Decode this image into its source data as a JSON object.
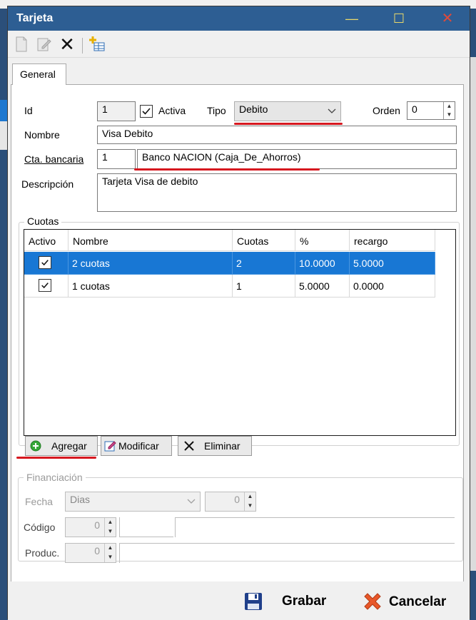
{
  "window": {
    "title": "Tarjeta"
  },
  "titlebar": {
    "min_glyph": "—",
    "max_glyph": "☐",
    "close_glyph": "✕"
  },
  "toolbar": {
    "delete_glyph": "✕"
  },
  "tabs": [
    {
      "label": "General"
    }
  ],
  "form": {
    "id_label": "Id",
    "id_value": "1",
    "activa_label": "Activa",
    "activa_checked": true,
    "tipo_label": "Tipo",
    "tipo_value": "Debito",
    "orden_label": "Orden",
    "orden_value": "0",
    "nombre_label": "Nombre",
    "nombre_value": "Visa Debito",
    "cta_label": "Cta. bancaria",
    "cta_code": "1",
    "cta_name": "Banco NACION (Caja_De_Ahorros)",
    "descripcion_label": "Descripción",
    "descripcion_value": "Tarjeta Visa de debito"
  },
  "cuotas": {
    "group_label": "Cuotas",
    "columns": [
      "Activo",
      "Nombre",
      "Cuotas",
      "%",
      "recargo"
    ],
    "rows": [
      {
        "activo": true,
        "nombre": "2 cuotas",
        "cuotas": "2",
        "pct": "10.0000",
        "recargo": "5.0000",
        "selected": true
      },
      {
        "activo": true,
        "nombre": "1 cuotas",
        "cuotas": "1",
        "pct": "5.0000",
        "recargo": "0.0000",
        "selected": false
      }
    ],
    "btn_agregar": "Agregar",
    "btn_modificar": "Modificar",
    "btn_eliminar": "Eliminar"
  },
  "financiacion": {
    "group_label": "Financiación",
    "fecha_label": "Fecha",
    "fecha_value": "Dias",
    "fecha_num": "0",
    "codigo_label": "Código",
    "codigo_value": "0",
    "produc_label": "Produc.",
    "produc_value": "0"
  },
  "footer": {
    "grabar": "Grabar",
    "cancelar": "Cancelar"
  },
  "colors": {
    "title_bar": "#2d5e93",
    "selection": "#1877d4",
    "accent_underline": "#d6181f"
  }
}
